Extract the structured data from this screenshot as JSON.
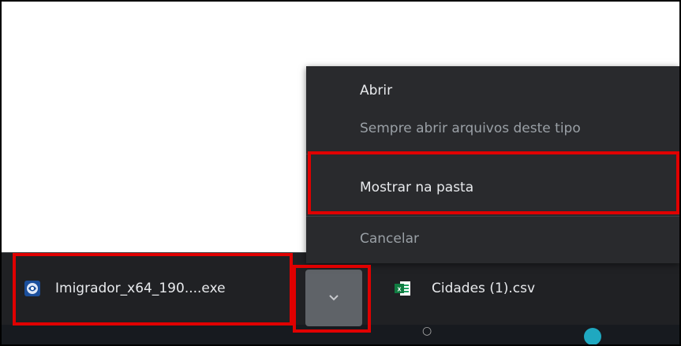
{
  "menu": {
    "items": [
      {
        "label": "Abrir",
        "enabled": true
      },
      {
        "label": "Sempre abrir arquivos deste tipo",
        "enabled": false
      },
      {
        "label": "Mostrar na pasta",
        "enabled": true,
        "highlighted": true
      },
      {
        "label": "Cancelar",
        "enabled": false
      }
    ]
  },
  "download_bar": {
    "items": [
      {
        "filename": "Imigrador_x64_190....exe",
        "icon": "installer-icon"
      },
      {
        "filename": "Cidades (1).csv",
        "icon": "excel-icon"
      }
    ],
    "menu_button_icon": "chevron-down-icon"
  },
  "colors": {
    "highlight": "#e00000",
    "menu_bg": "#292a2d",
    "bar_bg": "#202124"
  }
}
